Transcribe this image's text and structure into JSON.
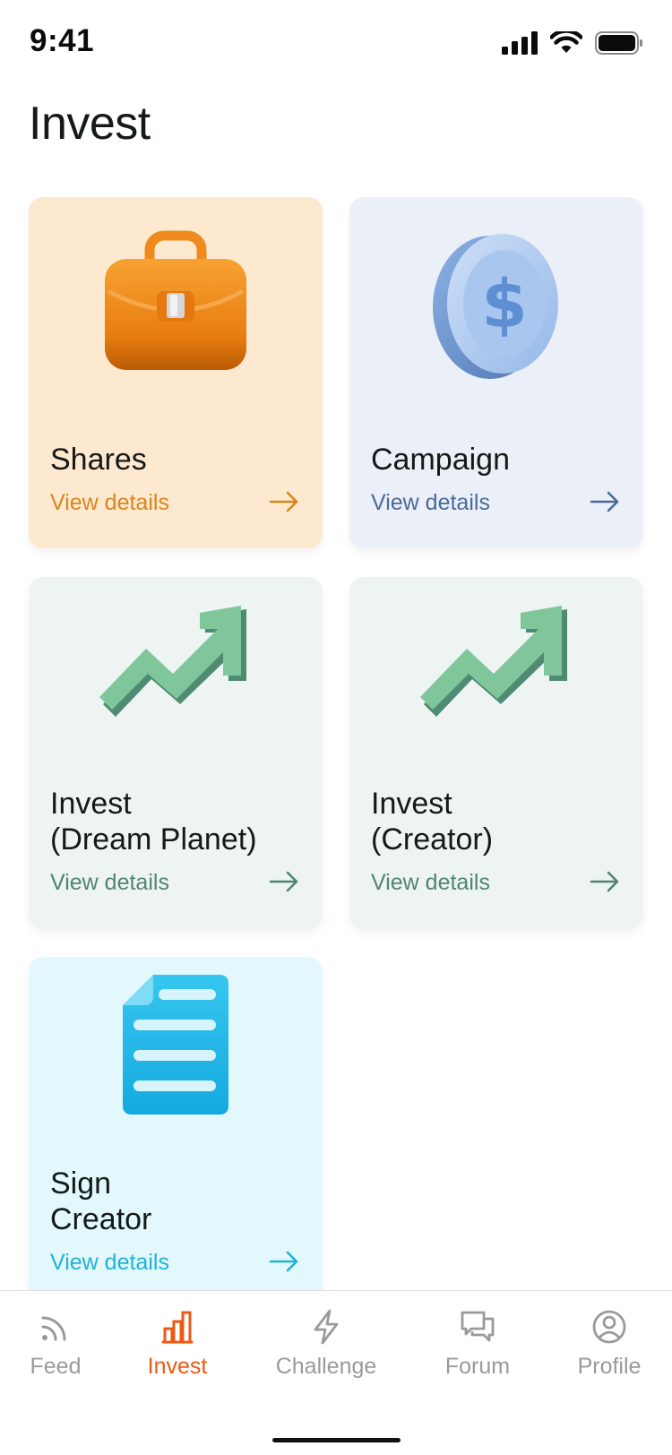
{
  "status": {
    "time": "9:41"
  },
  "page": {
    "title": "Invest"
  },
  "cards": [
    {
      "title": "Shares",
      "link": "View details",
      "icon": "briefcase-icon",
      "bg": "#fde8d0",
      "accent": "#d9861c"
    },
    {
      "title": "Campaign",
      "link": "View details",
      "icon": "dollar-coin-icon",
      "bg": "#ebeff7",
      "accent": "#4a6a9a"
    },
    {
      "title": "Invest\n(Dream Planet)",
      "link": "View details",
      "icon": "trending-up-arrow-icon",
      "bg": "#eef4f1",
      "accent": "#4f8575"
    },
    {
      "title": "Invest\n(Creator)",
      "link": "View details",
      "icon": "trending-up-arrow-icon",
      "bg": "#eef4f1",
      "accent": "#4f8575"
    },
    {
      "title": "Sign\nCreator",
      "link": "View details",
      "icon": "document-icon",
      "bg": "#e3f8fd",
      "accent": "#1fb3d6"
    }
  ],
  "tabbar": {
    "items": [
      {
        "label": "Feed",
        "icon": "feed-icon",
        "active": false
      },
      {
        "label": "Invest",
        "icon": "bar-chart-icon",
        "active": true
      },
      {
        "label": "Challenge",
        "icon": "lightning-icon",
        "active": false
      },
      {
        "label": "Forum",
        "icon": "chat-bubbles-icon",
        "active": false
      },
      {
        "label": "Profile",
        "icon": "profile-icon",
        "active": false
      }
    ],
    "active_color": "#ea5a14",
    "inactive_color": "#9a9a9a"
  }
}
